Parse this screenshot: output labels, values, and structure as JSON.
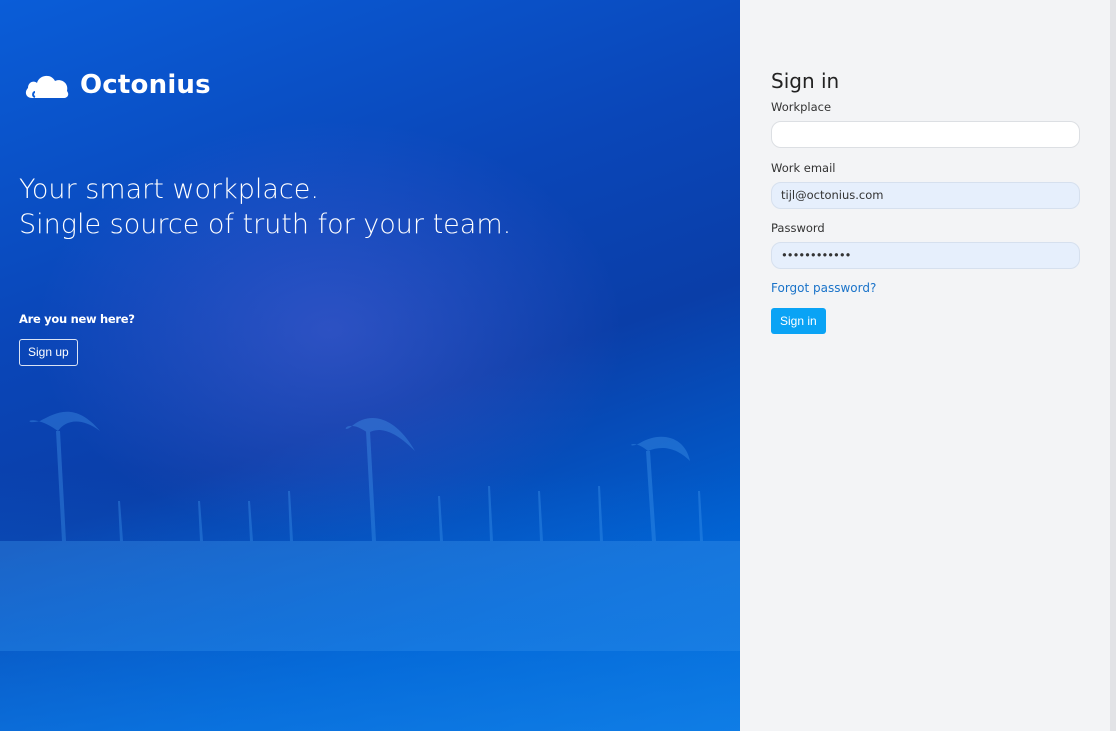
{
  "brand": {
    "name": "Octonius",
    "logo_icon": "cloud-logo-icon"
  },
  "hero": {
    "tagline_line1": "Your smart workplace.",
    "tagline_line2": "Single source of truth for your team.",
    "new_here": "Are you new here?",
    "signup_label": "Sign up"
  },
  "form": {
    "title": "Sign in",
    "workplace_label": "Workplace",
    "workplace_value": "",
    "email_label": "Work email",
    "email_value": "tijl@octonius.com",
    "password_label": "Password",
    "password_value": "••••••••••••",
    "forgot_label": "Forgot password?",
    "signin_label": "Sign in"
  },
  "colors": {
    "hero_blue": "#0a46b8",
    "panel_bg": "#f3f4f6",
    "accent_button": "#0aa3f5",
    "link": "#1a73c9",
    "filled_input": "#e6effc"
  }
}
